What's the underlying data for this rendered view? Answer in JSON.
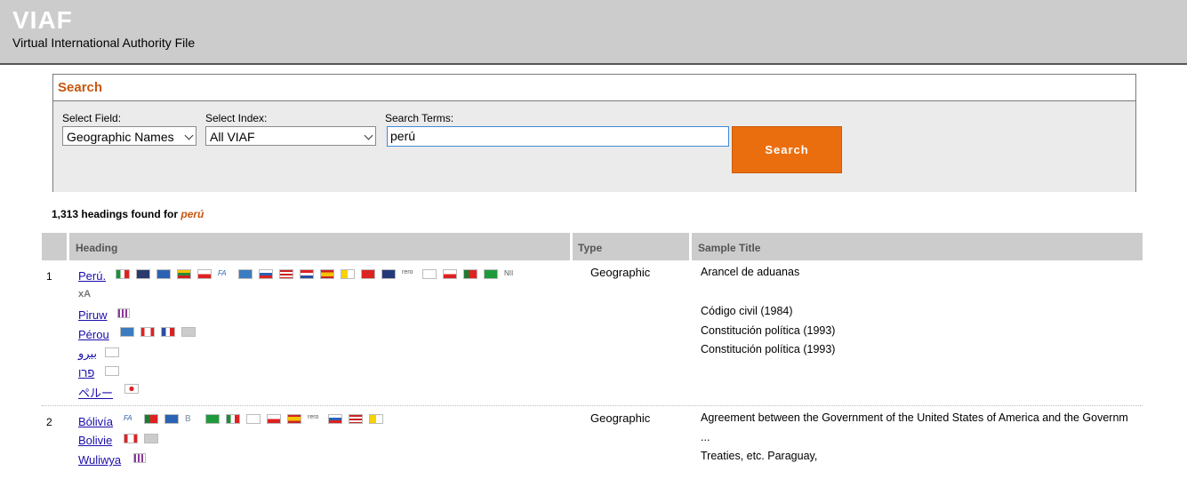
{
  "app": {
    "logo": "VIAF",
    "subtitle": "Virtual International Authority File"
  },
  "search": {
    "title": "Search",
    "field_label": "Select Field:",
    "field_value": "Geographic Names",
    "index_label": "Select Index:",
    "index_value": "All VIAF",
    "terms_label": "Search Terms:",
    "terms_value": "perú",
    "button_label": "Search"
  },
  "results": {
    "count_text": "1,313 headings found for",
    "term": "perú",
    "columns": {
      "heading": "Heading",
      "type": "Type",
      "sample": "Sample Title"
    },
    "rows": [
      {
        "num": "1",
        "type": "Geographic",
        "headings": [
          "Perú.",
          "Piruw",
          "Pérou",
          "بيرو",
          "פרו",
          "ペルー"
        ],
        "xa": "xA",
        "titles": [
          "Arancel de aduanas",
          "Código civil (1984)",
          "Constitución política (1993)",
          "Constitución política (1993)"
        ]
      },
      {
        "num": "2",
        "type": "Geographic",
        "headings": [
          "Bólivía",
          "Bolivie",
          "Wuliwya"
        ],
        "titles": [
          "Agreement between the Government of the United States of America and the Governm",
          "...",
          "Treaties, etc. Paraguay,"
        ]
      }
    ]
  },
  "colors": {
    "accent": "#eb6e0e",
    "title_orange": "#c8560f",
    "header_bg": "#cccccc",
    "link": "#1a0dab"
  }
}
